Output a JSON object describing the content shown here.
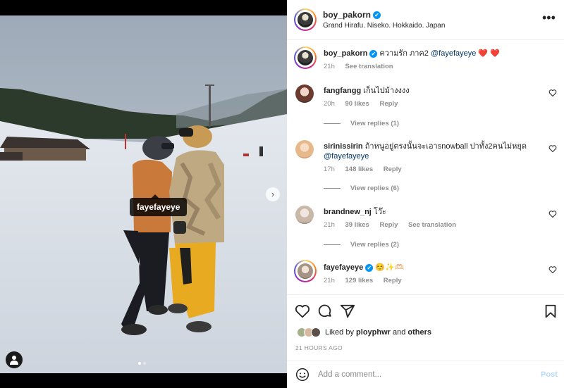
{
  "post": {
    "author": "boy_pakorn",
    "location": "Grand Hirafu. Niseko. Hokkaido. Japan",
    "tag_label": "fayefayeye",
    "verified_mark": "✔"
  },
  "caption": {
    "username": "boy_pakorn",
    "text": "ความรัก ภาค2",
    "mention": "@fayefayeye",
    "hearts": "❤️ ❤️",
    "time": "21h",
    "translate": "See translation"
  },
  "comments": [
    {
      "username": "fangfangg",
      "text": "เก็นไปม้างงงง",
      "time": "20h",
      "likes": "90 likes",
      "reply": "Reply",
      "view_replies": "View replies (1)"
    },
    {
      "username": "sirinissirin",
      "text": "ถ้าหนูอยู่ตรงนั้นจะเอาsnowball ปาทั้ง2คนไม่หยุด",
      "mention": "@fayefayeye",
      "time": "17h",
      "likes": "148 likes",
      "reply": "Reply",
      "view_replies": "View replies (6)"
    },
    {
      "username": "brandnew_nj",
      "text": "โว๊ะ",
      "time": "21h",
      "likes": "39 likes",
      "reply": "Reply",
      "translate": "See translation",
      "view_replies": "View replies (2)"
    },
    {
      "username": "fayefayeye",
      "text": "☺️✨🫶🏻",
      "time": "21h",
      "likes": "129 likes",
      "reply": "Reply"
    }
  ],
  "likes": {
    "prefix": "Liked by",
    "user": "ployphwr",
    "and": "and",
    "others": "others",
    "timestamp": "21 HOURS AGO"
  },
  "add_comment": {
    "placeholder": "Add a comment...",
    "post_label": "Post"
  },
  "colors": {
    "accent": "#0095f6",
    "post_disabled": "#b3dbff",
    "heart": "#ed4956"
  },
  "icons": [
    "more-icon",
    "heart-icon",
    "comment-icon",
    "share-icon",
    "bookmark-icon",
    "emoji-icon",
    "user-tag-icon",
    "chevron-right-icon",
    "verified-icon"
  ]
}
